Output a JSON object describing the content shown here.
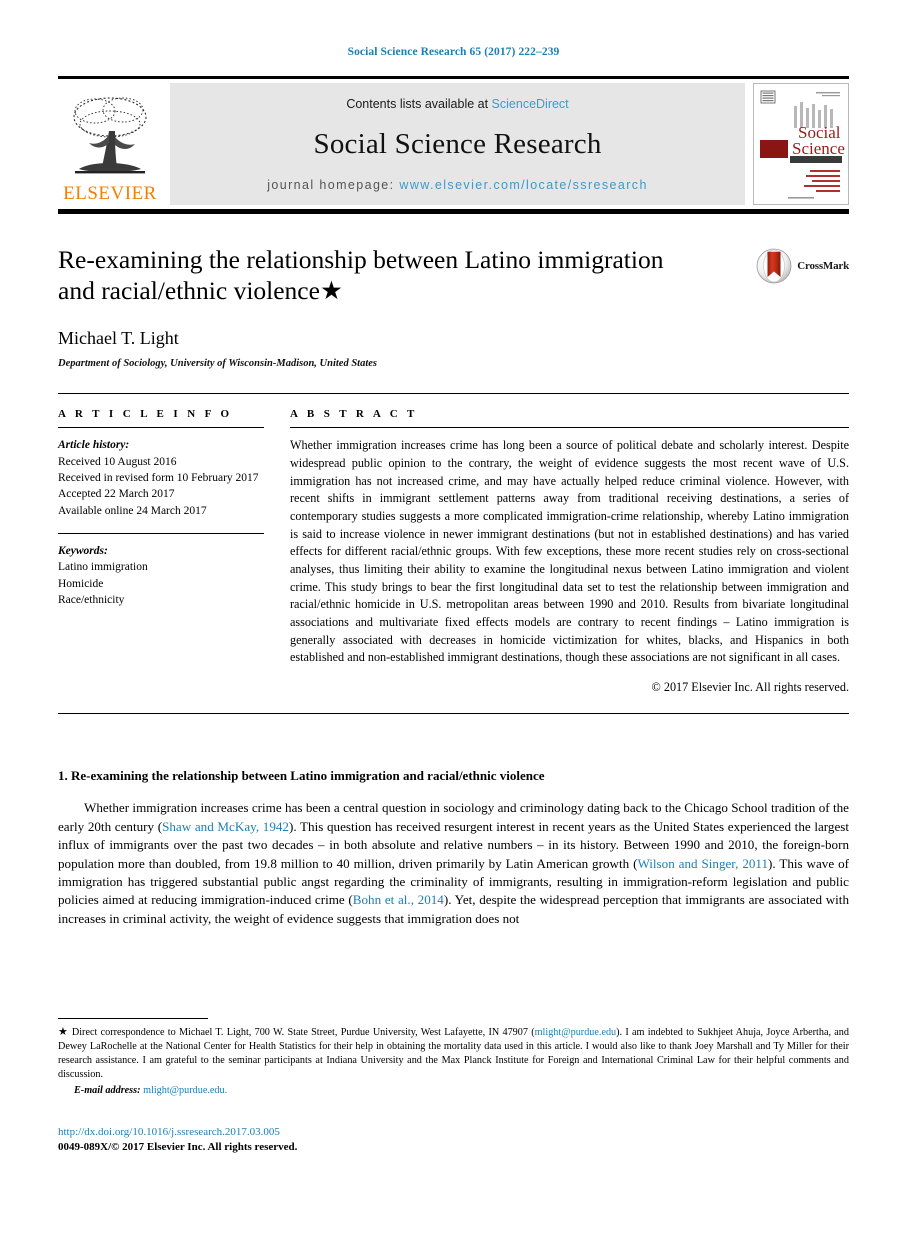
{
  "running_head": "Social Science Research 65 (2017) 222–239",
  "masthead": {
    "contents_prefix": "Contents lists available at ",
    "contents_link": "ScienceDirect",
    "journal_name": "Social Science Research",
    "homepage_prefix": "journal homepage: ",
    "homepage_url": "www.elsevier.com/locate/ssresearch",
    "publisher_wordmark": "ELSEVIER",
    "cover_title_line1": "Social",
    "cover_title_line2": "Science",
    "cover_title_line3": "RESEARCH",
    "colors": {
      "link_blue": "#3a9bd0",
      "elsevier_orange": "#f08000",
      "running_head_blue": "#1a7fb5",
      "cover_red": "#9b1b1b",
      "banner_grey": "#e6e6e6"
    }
  },
  "article": {
    "title": "Re-examining the relationship between Latino immigration and racial/ethnic violence★",
    "author": "Michael T. Light",
    "affiliation": "Department of Sociology, University of Wisconsin-Madison, United States",
    "crossmark_label": "CrossMark"
  },
  "article_info": {
    "heading": "A R T I C L E   I N F O",
    "history_label": "Article history:",
    "history": [
      "Received 10 August 2016",
      "Received in revised form 10 February 2017",
      "Accepted 22 March 2017",
      "Available online 24 March 2017"
    ],
    "keywords_label": "Keywords:",
    "keywords": [
      "Latino immigration",
      "Homicide",
      "Race/ethnicity"
    ]
  },
  "abstract": {
    "heading": "A B S T R A C T",
    "text": "Whether immigration increases crime has long been a source of political debate and scholarly interest. Despite widespread public opinion to the contrary, the weight of evidence suggests the most recent wave of U.S. immigration has not increased crime, and may have actually helped reduce criminal violence. However, with recent shifts in immigrant settlement patterns away from traditional receiving destinations, a series of contemporary studies suggests a more complicated immigration-crime relationship, whereby Latino immigration is said to increase violence in newer immigrant destinations (but not in established destinations) and has varied effects for different racial/ethnic groups. With few exceptions, these more recent studies rely on cross-sectional analyses, thus limiting their ability to examine the longitudinal nexus between Latino immigration and violent crime. This study brings to bear the first longitudinal data set to test the relationship between immigration and racial/ethnic homicide in U.S. metropolitan areas between 1990 and 2010. Results from bivariate longitudinal associations and multivariate fixed effects models are contrary to recent findings – Latino immigration is generally associated with decreases in homicide victimization for whites, blacks, and Hispanics in both established and non-established immigrant destinations, though these associations are not significant in all cases.",
    "copyright": "© 2017 Elsevier Inc. All rights reserved."
  },
  "body": {
    "section_heading": "1. Re-examining the relationship between Latino immigration and racial/ethnic violence",
    "paragraph_1": {
      "part_1": "Whether immigration increases crime has been a central question in sociology and criminology dating back to the Chicago School tradition of the early 20th century (",
      "ref_1": "Shaw and McKay, 1942",
      "part_2": "). This question has received resurgent interest in recent years as the United States experienced the largest influx of immigrants over the past two decades – in both absolute and relative numbers – in its history. Between 1990 and 2010, the foreign-born population more than doubled, from 19.8 million to 40 million, driven primarily by Latin American growth (",
      "ref_2": "Wilson and Singer, 2011",
      "part_3": "). This wave of immigration has triggered substantial public angst regarding the criminality of immigrants, resulting in immigration-reform legislation and public policies aimed at reducing immigration-induced crime (",
      "ref_3": "Bohn et al., 2014",
      "part_4": "). Yet, despite the widespread perception that immigrants are associated with increases in criminal activity, the weight of evidence suggests that immigration does not"
    }
  },
  "footnotes": {
    "star_marker": "★",
    "correspondence_part_1": " Direct correspondence to Michael T. Light, 700 W. State Street, Purdue University, West Lafayette, IN 47907 (",
    "correspondence_email": "mlight@purdue.edu",
    "correspondence_part_2": "). I am indebted to Sukhjeet Ahuja, Joyce Arbertha, and Dewey LaRochelle at the National Center for Health Statistics for their help in obtaining the mortality data used in this article. I would also like to thank Joey Marshall and Ty Miller for their research assistance. I am grateful to the seminar participants at Indiana University and the Max Planck Institute for Foreign and International Criminal Law for their helpful comments and discussion.",
    "email_label": "E-mail address:",
    "email_value": "mlight@purdue.edu."
  },
  "footer": {
    "doi": "http://dx.doi.org/10.1016/j.ssresearch.2017.03.005",
    "issn_line": "0049-089X/© 2017 Elsevier Inc. All rights reserved."
  }
}
